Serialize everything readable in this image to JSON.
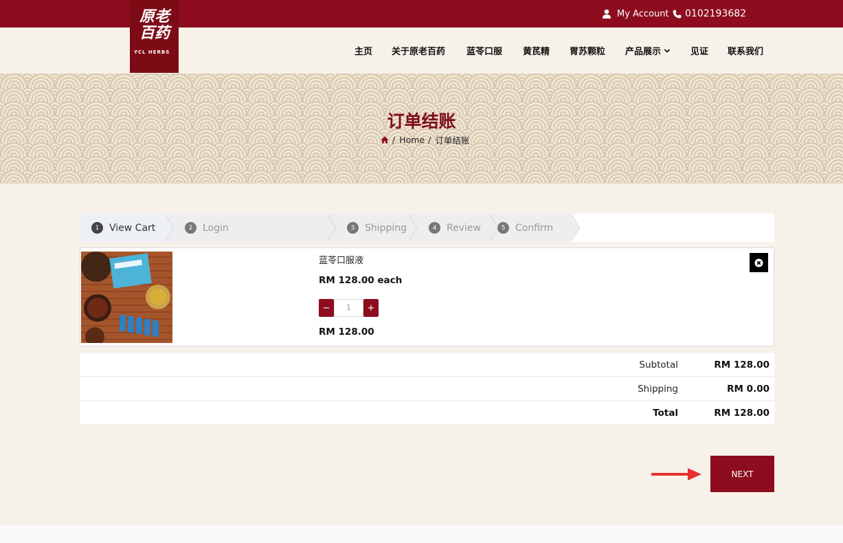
{
  "header": {
    "account_label": "My Account",
    "phone": "0102193682",
    "logo_text": "原老百药",
    "logo_en": "YCL HERBS"
  },
  "nav": {
    "items": [
      {
        "label": "主页"
      },
      {
        "label": "关于原老百药"
      },
      {
        "label": "蓝苓口服"
      },
      {
        "label": "黄芪精"
      },
      {
        "label": "胃苏颗粒"
      },
      {
        "label": "产品展示"
      },
      {
        "label": "见证"
      },
      {
        "label": "联系我们"
      }
    ]
  },
  "hero": {
    "title": "订单结账",
    "breadcrumb": {
      "sep": "/",
      "home": "Home",
      "current": "订单结账"
    }
  },
  "steps": [
    {
      "num": "1",
      "label": "View Cart",
      "active": true
    },
    {
      "num": "2",
      "label": "Login",
      "active": false
    },
    {
      "num": "3",
      "label": "Shipping",
      "active": false
    },
    {
      "num": "4",
      "label": "Review",
      "active": false
    },
    {
      "num": "5",
      "label": "Confirm",
      "active": false
    }
  ],
  "cart": {
    "item": {
      "name": "蓝苓口服液",
      "price_each": "RM 128.00 each",
      "qty_minus": "−",
      "qty": "1",
      "qty_plus": "+",
      "line_total": "RM 128.00"
    }
  },
  "totals": {
    "subtotal_label": "Subtotal",
    "subtotal": "RM 128.00",
    "shipping_label": "Shipping",
    "shipping": "RM 0.00",
    "total_label": "Total",
    "total": "RM 128.00"
  },
  "actions": {
    "next_label": "NEXT"
  },
  "colors": {
    "brand": "#8d0d1e",
    "page_bg": "#f6f2ea",
    "annotation_arrow": "#e8302f"
  }
}
